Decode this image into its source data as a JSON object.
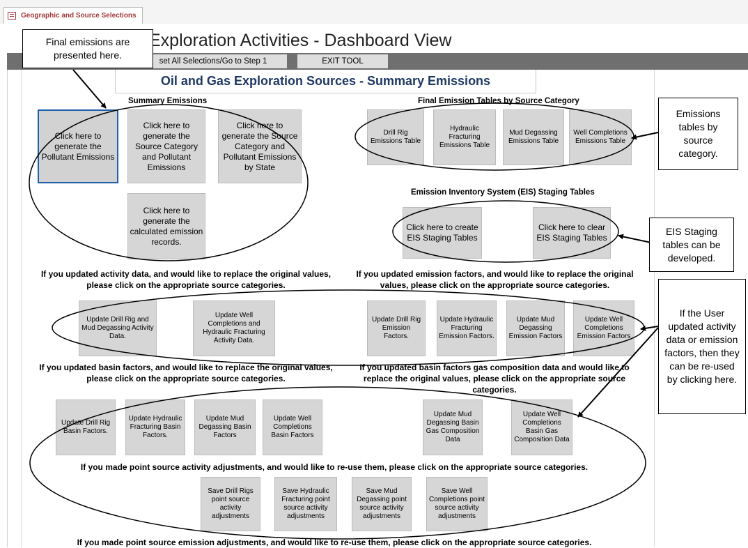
{
  "tab": {
    "label": "Geographic and Source Selections",
    "icon": "form-icon"
  },
  "form": {
    "title": "Exploration Activities - Dashboard View"
  },
  "toolbar": {
    "reset_label": "set All Selections/Go to Step 1",
    "exit_label": "EXIT TOOL"
  },
  "summary_title": "Oil and Gas Exploration Sources - Summary Emissions",
  "sections": {
    "summary_emissions": "Summary Emissions",
    "final_tables": "Final Emission Tables by Source Category",
    "eis_staging": "Emission Inventory System (EIS) Staging Tables"
  },
  "buttons": {
    "pollutant": "Click here to generate the Pollutant Emissions",
    "source_category": "Click here to generate the Source Category and Pollutant Emissions",
    "by_state": "Click here to generate the Source Category and Pollutant Emissions by State",
    "calculated_records": "Click here to generate the calculated emission records.",
    "drill_rig_table": "Drill Rig Emissions Table",
    "hf_table": "Hydraulic Fracturing Emissions Table",
    "mud_table": "Mud Degassing Emissions Table",
    "well_table": "Well Completions Emissions Table",
    "create_eis": "Click here to create EIS Staging Tables",
    "clear_eis": "Click here to clear EIS Staging Tables",
    "upd_drill_mud_activity": "Update Drill Rig and Mud Degassing Activity Data.",
    "upd_well_hf_activity": "Update Well Completions and Hydraulic Fracturing Activity Data.",
    "upd_drill_ef": "Update Drill Rig Emission Factors.",
    "upd_hf_ef": "Update Hydraulic Fracturing Emission Factors.",
    "upd_mud_ef": "Update Mud Degassing Emission Factors",
    "upd_well_ef": "Update Well Completions Emission Factors",
    "upd_drill_basin": "Update Drill Rig Basin Factors.",
    "upd_hf_basin": "Update Hydraulic Fracturing Basin Factors.",
    "upd_mud_basin": "Update Mud Degassing Basin Factors",
    "upd_well_basin": "Update Well Completions Basin Factors",
    "upd_mud_gas": "Update Mud Degassing Basin Gas Composition Data",
    "upd_well_gas": "Update Well Completions Basin Gas Composition Data",
    "save_drill": "Save Drill Rigs point source activity adjustments",
    "save_hf": "Save Hydraulic Fracturing point source activity adjustments",
    "save_mud": "Save Mud Degassing point source activity adjustments",
    "save_well": "Save Well Completions point source activity adjustments"
  },
  "paragraphs": {
    "activity": "If you updated activity data, and would like to replace the original values, please click on the appropriate source categories.",
    "emission_factors": "If you updated emission factors, and would like to replace the original values, please click on the appropriate source categories.",
    "basin_factors": "If you updated basin factors, and would like to replace the original values, please click on the appropriate source categories.",
    "gas_composition": "If you updated basin factors gas composition data and would like to replace the original values, please click on the appropriate source categories.",
    "point_activity": "If you made point source activity adjustments, and would like to re-use them, please click on the appropriate source categories.",
    "point_emission": "If you made point source emission adjustments, and would like to re-use them, please click on the appropriate source categories."
  },
  "callouts": {
    "final_emissions": "Final emissions are presented here.",
    "tables_by_category": "Emissions tables by source category.",
    "eis_staging": "EIS Staging tables can be developed.",
    "reuse": "If the User updated activity data or emission factors, then they can be re-used by clicking here."
  }
}
